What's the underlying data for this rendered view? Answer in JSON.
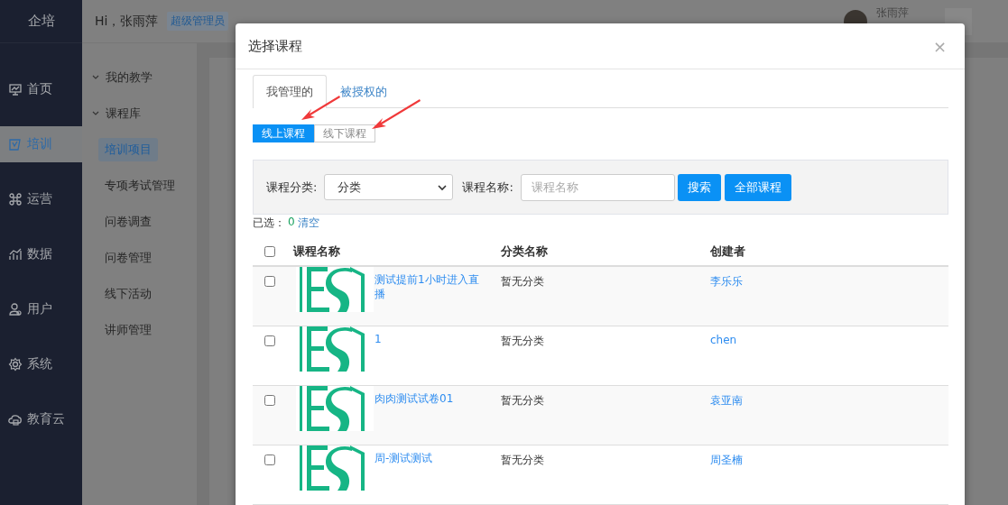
{
  "app": {
    "logo": "企培"
  },
  "nav": [
    {
      "label": "首页",
      "selected": false
    },
    {
      "label": "培训",
      "selected": true
    },
    {
      "label": "运营",
      "selected": false
    },
    {
      "label": "数据",
      "selected": false
    },
    {
      "label": "用户",
      "selected": false
    },
    {
      "label": "系统",
      "selected": false
    },
    {
      "label": "教育云",
      "selected": false
    }
  ],
  "header": {
    "greeting": "Hi，张雨萍",
    "role_badge": "超级管理员",
    "user_name": "张雨萍"
  },
  "submenu": [
    {
      "kind": "group",
      "label": "我的教学"
    },
    {
      "kind": "group",
      "label": "课程库"
    },
    {
      "kind": "link",
      "label": "培训项目",
      "selected": true
    },
    {
      "kind": "link",
      "label": "专项考试管理",
      "selected": false
    },
    {
      "kind": "link",
      "label": "问卷调查",
      "selected": false
    },
    {
      "kind": "link",
      "label": "问卷管理",
      "selected": false
    },
    {
      "kind": "link",
      "label": "线下活动",
      "selected": false
    },
    {
      "kind": "link",
      "label": "讲师管理",
      "selected": false
    }
  ],
  "dialog": {
    "title": "选择课程",
    "close": "×",
    "tabs": [
      {
        "label": "我管理的",
        "selected": true
      },
      {
        "label": "被授权的",
        "selected": false
      }
    ],
    "course_types": [
      {
        "label": "线上课程",
        "selected": true
      },
      {
        "label": "线下课程",
        "selected": false
      }
    ],
    "filter": {
      "category_label": "课程分类:",
      "category_value": "分类",
      "name_label": "课程名称:",
      "name_placeholder": "课程名称",
      "buttons": [
        "搜索",
        "全部课程"
      ]
    },
    "selection": {
      "label": "已选：",
      "count": "0",
      "clear": "清空"
    },
    "table": {
      "all_checked": false,
      "columns": [
        "课程名称",
        "分类名称",
        "创建者"
      ],
      "rows": [
        {
          "name": "测试提前1小时进入直播",
          "category": "暂无分类",
          "creator": "李乐乐",
          "checked": false
        },
        {
          "name": "1",
          "category": "暂无分类",
          "creator": "chen",
          "checked": false
        },
        {
          "name": "肉肉测试试卷01",
          "category": "暂无分类",
          "creator": "袁亚南",
          "checked": false
        },
        {
          "name": "周-测试测试",
          "category": "暂无分类",
          "creator": "周圣楠",
          "checked": false
        }
      ]
    }
  }
}
